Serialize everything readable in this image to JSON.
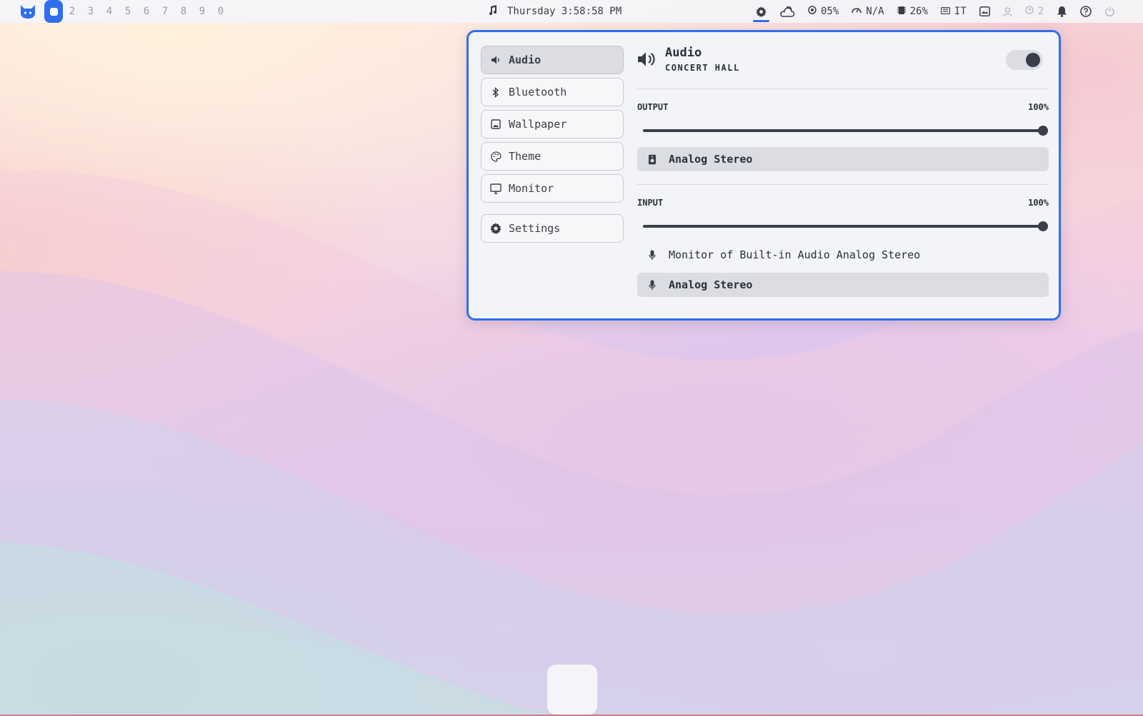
{
  "topbar": {
    "workspaces": [
      "2",
      "3",
      "4",
      "5",
      "6",
      "7",
      "8",
      "9",
      "0"
    ],
    "clock": "Thursday 3:58:58 PM",
    "cpu": "05%",
    "network": "N/A",
    "memory": "26%",
    "keyboard_layout": "IT",
    "notification_count": "2",
    "accent_color": "#2f6fec"
  },
  "panel": {
    "nav": {
      "audio": "Audio",
      "bluetooth": "Bluetooth",
      "wallpaper": "Wallpaper",
      "theme": "Theme",
      "monitor": "Monitor",
      "settings": "Settings"
    },
    "header": {
      "title": "Audio",
      "subtitle": "CONCERT HALL",
      "enabled": true
    },
    "output": {
      "label": "OUTPUT",
      "value_text": "100%",
      "level": 1.0,
      "devices": [
        {
          "name": "Analog Stereo",
          "selected": true,
          "icon": "speaker-icon"
        }
      ]
    },
    "input": {
      "label": "INPUT",
      "value_text": "100%",
      "level": 1.0,
      "devices": [
        {
          "name": "Monitor of Built-in Audio Analog Stereo",
          "selected": false,
          "icon": "microphone-icon"
        },
        {
          "name": "Analog Stereo",
          "selected": true,
          "icon": "microphone-icon"
        }
      ]
    }
  }
}
